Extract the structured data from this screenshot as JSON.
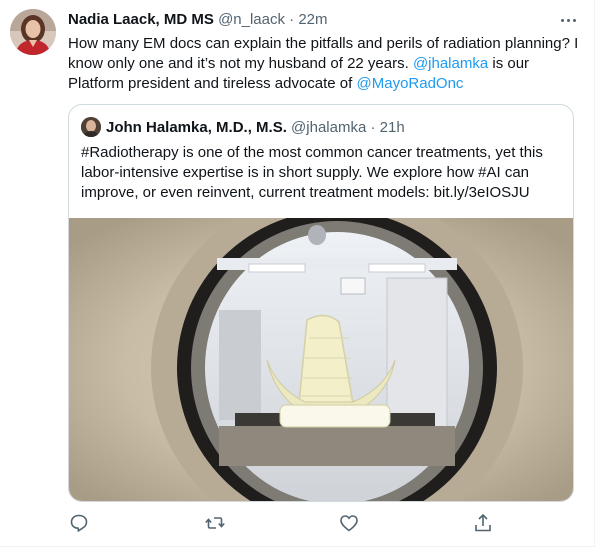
{
  "tweet": {
    "author_name": "Nadia Laack, MD MS",
    "handle": "@n_laack",
    "separator": "·",
    "time": "22m",
    "text_1": "How many EM docs can explain the pitfalls and perils of radiation planning? I know only one and it’s not my husband of 22 years. ",
    "mention_1": "@jhalamka",
    "text_2": " is our Platform president and tireless advocate of ",
    "mention_2": "@MayoRadOnc"
  },
  "quoted_tweet": {
    "author_name": "John Halamka, M.D., M.S.",
    "handle": "@jhalamka",
    "separator": "·",
    "time": "21h",
    "text": "#Radiotherapy is one of the most common cancer treatments, yet this labor-intensive expertise is in short supply. We explore how #AI can improve, or even reinvent, current treatment models: bit.ly/3eIOSJU"
  },
  "actions": [
    {
      "icon": "reply-icon"
    },
    {
      "icon": "retweet-icon"
    },
    {
      "icon": "like-icon"
    },
    {
      "icon": "share-icon"
    }
  ],
  "colors": {
    "link": "#1d9bf0",
    "text": "#0f1419",
    "muted": "#536471",
    "border": "#cfd9de"
  }
}
